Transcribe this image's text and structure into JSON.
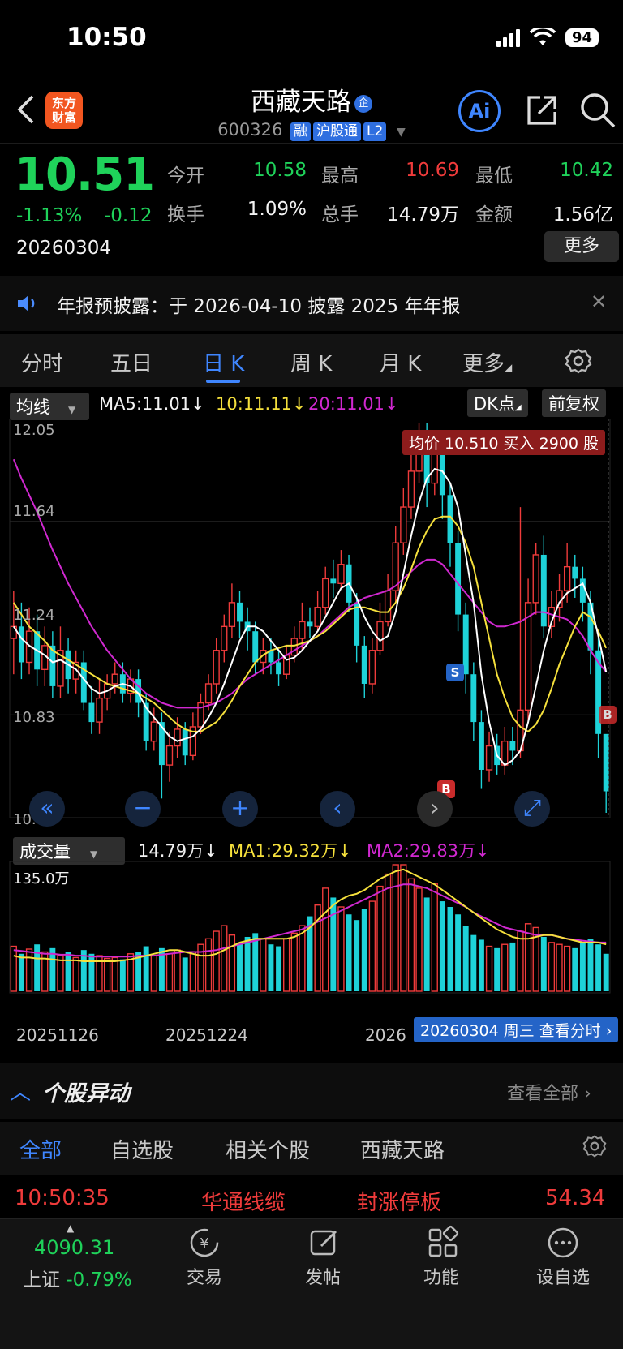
{
  "status": {
    "time": "10:50",
    "battery": "94"
  },
  "header": {
    "logo_line1": "东方",
    "logo_line2": "财富",
    "stock_name": "西藏天路",
    "name_tag": "企",
    "stock_code": "600326",
    "badges": [
      "融",
      "沪股通",
      "L2"
    ],
    "ai_label": "Ai"
  },
  "quote": {
    "price": "10.51",
    "change_pct": "-1.13%",
    "change_amt": "-0.12",
    "date": "20260304",
    "fields": [
      {
        "label": "今开",
        "value": "10.58",
        "color": "#1fd25a"
      },
      {
        "label": "最高",
        "value": "10.69",
        "color": "#ef3b3b"
      },
      {
        "label": "最低",
        "value": "10.42",
        "color": "#1fd25a"
      },
      {
        "label": "换手",
        "value": "1.09%",
        "color": "#f2f2f2"
      },
      {
        "label": "总手",
        "value": "14.79万",
        "color": "#f2f2f2"
      },
      {
        "label": "金额",
        "value": "1.56亿",
        "color": "#f2f2f2"
      }
    ],
    "more_label": "更多"
  },
  "notice": {
    "text": "年报预披露：于 2026-04-10 披露 2025 年年报"
  },
  "ktabs": [
    "分时",
    "五日",
    "日 K",
    "周 K",
    "月 K",
    "更多"
  ],
  "kchart": {
    "indicator_label": "均线",
    "ma5": "MA5:11.01↓",
    "ma10": "10:11.11↓",
    "ma20": "20:11.01↓",
    "dk_label": "DK点",
    "fq_label": "前复权",
    "avg_tag": "均价 10.510 买入 2900 股",
    "y_labels": [
      "12.05",
      "11.64",
      "11.24",
      "10.83",
      "10.42"
    ],
    "marker_s": "S",
    "marker_b": "B"
  },
  "volume": {
    "indicator_label": "成交量",
    "current": "14.79万↓",
    "ma1": "MA1:29.32万↓",
    "ma2": "MA2:29.83万↓",
    "max_label": "135.0万",
    "x_labels": [
      "20251126",
      "20251224",
      "2026"
    ],
    "date_tag": "20260304 周三  查看分时"
  },
  "colors": {
    "up": "#ef3b3b",
    "down": "#1ed2d8",
    "ma5": "#ffffff",
    "ma10": "#f5e03c",
    "ma20": "#d028d0",
    "accent": "#3f86ff"
  },
  "chart_data": {
    "type": "candlestick",
    "ylim": [
      10.42,
      12.05
    ],
    "candles": [
      [
        11.15,
        11.2,
        11.35,
        11.0
      ],
      [
        11.2,
        11.05,
        11.3,
        10.98
      ],
      [
        11.05,
        11.18,
        11.28,
        11.0
      ],
      [
        11.18,
        11.02,
        11.25,
        10.95
      ],
      [
        11.02,
        11.12,
        11.2,
        10.95
      ],
      [
        11.12,
        10.95,
        11.18,
        10.9
      ],
      [
        10.95,
        11.1,
        11.2,
        10.9
      ],
      [
        11.1,
        10.98,
        11.15,
        10.92
      ],
      [
        10.98,
        11.05,
        11.1,
        10.92
      ],
      [
        11.05,
        10.88,
        11.1,
        10.85
      ],
      [
        10.88,
        10.8,
        10.95,
        10.75
      ],
      [
        10.8,
        10.9,
        10.98,
        10.75
      ],
      [
        10.9,
        10.96,
        11.0,
        10.85
      ],
      [
        10.96,
        11.0,
        11.05,
        10.92
      ],
      [
        11.0,
        10.92,
        11.05,
        10.88
      ],
      [
        10.92,
        10.98,
        11.02,
        10.88
      ],
      [
        10.98,
        10.88,
        11.02,
        10.82
      ],
      [
        10.88,
        10.72,
        10.92,
        10.68
      ],
      [
        10.72,
        10.8,
        10.86,
        10.68
      ],
      [
        10.8,
        10.62,
        10.84,
        10.48
      ],
      [
        10.62,
        10.7,
        10.76,
        10.55
      ],
      [
        10.7,
        10.77,
        10.82,
        10.65
      ],
      [
        10.77,
        10.66,
        10.8,
        10.62
      ],
      [
        10.66,
        10.78,
        10.84,
        10.64
      ],
      [
        10.78,
        10.88,
        10.92,
        10.75
      ],
      [
        10.88,
        10.96,
        11.0,
        10.85
      ],
      [
        10.96,
        11.1,
        11.15,
        10.92
      ],
      [
        11.1,
        11.2,
        11.25,
        11.05
      ],
      [
        11.2,
        11.3,
        11.38,
        11.15
      ],
      [
        11.3,
        11.22,
        11.35,
        11.15
      ],
      [
        11.22,
        11.18,
        11.28,
        11.1
      ],
      [
        11.18,
        11.05,
        11.22,
        11.0
      ],
      [
        11.05,
        11.1,
        11.15,
        11.0
      ],
      [
        11.1,
        11.05,
        11.15,
        11.0
      ],
      [
        11.05,
        11.0,
        11.1,
        10.95
      ],
      [
        11.0,
        11.08,
        11.12,
        10.98
      ],
      [
        11.08,
        11.15,
        11.2,
        11.05
      ],
      [
        11.15,
        11.22,
        11.3,
        11.1
      ],
      [
        11.22,
        11.2,
        11.28,
        11.15
      ],
      [
        11.2,
        11.28,
        11.35,
        11.18
      ],
      [
        11.28,
        11.4,
        11.45,
        11.25
      ],
      [
        11.4,
        11.38,
        11.48,
        11.32
      ],
      [
        11.38,
        11.46,
        11.52,
        11.36
      ],
      [
        11.46,
        11.3,
        11.5,
        11.26
      ],
      [
        11.3,
        11.12,
        11.34,
        11.05
      ],
      [
        11.12,
        10.96,
        11.16,
        10.9
      ],
      [
        10.96,
        11.1,
        11.15,
        10.92
      ],
      [
        11.1,
        11.22,
        11.3,
        11.08
      ],
      [
        11.22,
        11.35,
        11.42,
        11.2
      ],
      [
        11.35,
        11.55,
        11.62,
        11.3
      ],
      [
        11.55,
        11.7,
        11.78,
        11.5
      ],
      [
        11.7,
        11.85,
        11.95,
        11.65
      ],
      [
        11.85,
        11.95,
        12.05,
        11.8
      ],
      [
        11.95,
        11.8,
        12.05,
        11.7
      ],
      [
        11.8,
        11.92,
        12.0,
        11.75
      ],
      [
        11.92,
        11.75,
        11.98,
        11.65
      ],
      [
        11.75,
        11.55,
        11.8,
        11.45
      ],
      [
        11.55,
        11.25,
        11.6,
        11.18
      ],
      [
        11.25,
        11.0,
        11.3,
        10.92
      ],
      [
        11.0,
        10.8,
        11.05,
        10.72
      ],
      [
        10.8,
        10.6,
        10.85,
        10.52
      ],
      [
        10.6,
        10.7,
        10.76,
        10.55
      ],
      [
        10.7,
        10.62,
        10.75,
        10.58
      ],
      [
        10.62,
        10.72,
        10.78,
        10.58
      ],
      [
        10.72,
        10.68,
        10.78,
        10.62
      ],
      [
        10.68,
        10.85,
        11.7,
        10.65
      ],
      [
        10.85,
        11.3,
        11.4,
        10.8
      ],
      [
        11.3,
        11.5,
        11.55,
        11.25
      ],
      [
        11.5,
        11.2,
        11.58,
        11.15
      ],
      [
        11.2,
        11.28,
        11.35,
        11.15
      ],
      [
        11.28,
        11.35,
        11.42,
        11.22
      ],
      [
        11.35,
        11.45,
        11.55,
        11.3
      ],
      [
        11.45,
        11.4,
        11.5,
        11.32
      ],
      [
        11.4,
        11.3,
        11.45,
        11.22
      ],
      [
        11.3,
        11.1,
        11.35,
        11.0
      ],
      [
        11.1,
        10.75,
        11.15,
        10.65
      ],
      [
        10.75,
        10.51,
        10.69,
        10.42
      ]
    ],
    "volumes": [
      48,
      40,
      45,
      50,
      42,
      46,
      38,
      42,
      36,
      44,
      40,
      38,
      35,
      36,
      34,
      40,
      42,
      48,
      38,
      46,
      40,
      44,
      36,
      42,
      50,
      56,
      64,
      70,
      60,
      52,
      58,
      62,
      56,
      50,
      48,
      56,
      62,
      70,
      80,
      92,
      110,
      100,
      90,
      82,
      76,
      88,
      96,
      112,
      125,
      135,
      135,
      120,
      110,
      100,
      115,
      96,
      90,
      82,
      70,
      60,
      55,
      48,
      46,
      50,
      52,
      64,
      72,
      68,
      58,
      52,
      50,
      48,
      46,
      52,
      56,
      50,
      40
    ],
    "ma5": [
      11.2,
      11.15,
      11.12,
      11.1,
      11.08,
      11.05,
      11.06,
      11.04,
      11.02,
      10.98,
      10.94,
      10.92,
      10.93,
      10.95,
      10.96,
      10.95,
      10.92,
      10.86,
      10.82,
      10.78,
      10.74,
      10.72,
      10.73,
      10.74,
      10.77,
      10.82,
      10.88,
      10.96,
      11.05,
      11.14,
      11.2,
      11.2,
      11.18,
      11.14,
      11.1,
      11.06,
      11.07,
      11.1,
      11.14,
      11.18,
      11.24,
      11.3,
      11.36,
      11.38,
      11.32,
      11.24,
      11.18,
      11.14,
      11.16,
      11.26,
      11.42,
      11.58,
      11.72,
      11.82,
      11.86,
      11.85,
      11.8,
      11.7,
      11.5,
      11.3,
      11.0,
      10.8,
      10.66,
      10.62,
      10.64,
      10.68,
      10.8,
      10.95,
      11.1,
      11.22,
      11.3,
      11.34,
      11.36,
      11.38,
      11.3,
      11.16,
      11.01
    ],
    "ma10": [
      11.3,
      11.25,
      11.2,
      11.17,
      11.14,
      11.1,
      11.08,
      11.06,
      11.04,
      11.02,
      11.0,
      10.98,
      10.96,
      10.95,
      10.94,
      10.93,
      10.92,
      10.9,
      10.88,
      10.85,
      10.82,
      10.79,
      10.77,
      10.76,
      10.76,
      10.78,
      10.8,
      10.84,
      10.89,
      10.95,
      11.0,
      11.05,
      11.08,
      11.1,
      11.11,
      11.12,
      11.12,
      11.13,
      11.14,
      11.16,
      11.18,
      11.21,
      11.24,
      11.27,
      11.28,
      11.28,
      11.27,
      11.26,
      11.26,
      11.3,
      11.36,
      11.44,
      11.53,
      11.6,
      11.65,
      11.66,
      11.66,
      11.62,
      11.55,
      11.45,
      11.3,
      11.15,
      11.0,
      10.9,
      10.82,
      10.78,
      10.76,
      10.79,
      10.85,
      10.94,
      11.04,
      11.12,
      11.2,
      11.26,
      11.24,
      11.18,
      11.11
    ],
    "ma20": [
      11.9,
      11.82,
      11.75,
      11.68,
      11.6,
      11.52,
      11.45,
      11.38,
      11.32,
      11.26,
      11.2,
      11.15,
      11.1,
      11.06,
      11.02,
      10.98,
      10.95,
      10.92,
      10.9,
      10.88,
      10.87,
      10.86,
      10.86,
      10.86,
      10.86,
      10.87,
      10.88,
      10.9,
      10.92,
      10.95,
      10.98,
      11.0,
      11.02,
      11.04,
      11.06,
      11.08,
      11.1,
      11.12,
      11.14,
      11.16,
      11.19,
      11.22,
      11.25,
      11.28,
      11.3,
      11.32,
      11.33,
      11.34,
      11.35,
      11.37,
      11.4,
      11.43,
      11.46,
      11.48,
      11.48,
      11.46,
      11.42,
      11.38,
      11.34,
      11.3,
      11.26,
      11.22,
      11.2,
      11.2,
      11.21,
      11.22,
      11.24,
      11.26,
      11.26,
      11.25,
      11.24,
      11.23,
      11.2,
      11.16,
      11.1,
      11.05,
      11.01
    ],
    "vol_ma1": [
      38,
      36,
      36,
      35,
      35,
      34,
      33,
      33,
      33,
      32,
      32,
      32,
      32,
      32,
      33,
      34,
      36,
      38,
      40,
      42,
      44,
      44,
      42,
      40,
      38,
      38,
      40,
      44,
      48,
      52,
      54,
      56,
      56,
      56,
      56,
      56,
      58,
      62,
      68,
      76,
      84,
      92,
      98,
      102,
      104,
      108,
      114,
      120,
      124,
      128,
      130,
      126,
      122,
      118,
      114,
      108,
      102,
      96,
      90,
      84,
      78,
      72,
      66,
      62,
      58,
      56,
      56,
      58,
      60,
      60,
      58,
      56,
      54,
      52,
      52,
      52,
      50
    ],
    "vol_ma2": [
      44,
      43,
      42,
      41,
      40,
      40,
      39,
      39,
      38,
      38,
      37,
      37,
      37,
      37,
      37,
      37,
      38,
      38,
      38,
      39,
      40,
      41,
      42,
      42,
      42,
      43,
      44,
      46,
      48,
      50,
      52,
      54,
      56,
      58,
      60,
      62,
      64,
      66,
      70,
      74,
      78,
      82,
      86,
      90,
      94,
      98,
      102,
      106,
      110,
      112,
      114,
      114,
      112,
      110,
      106,
      102,
      98,
      94,
      90,
      84,
      80,
      76,
      72,
      68,
      66,
      64,
      62,
      60,
      60,
      60,
      58,
      56,
      55,
      54,
      53,
      52,
      52
    ]
  },
  "movement": {
    "title": "个股异动",
    "view_all": "查看全部",
    "tabs": [
      "全部",
      "自选股",
      "相关个股",
      "西藏天路"
    ],
    "row": {
      "time": "10:50:35",
      "name": "华通线缆",
      "event": "封涨停板",
      "value": "54.34"
    }
  },
  "bottom_nav": {
    "index_value": "4090.31",
    "index_name": "上证",
    "index_change": "-0.79%",
    "items": [
      "交易",
      "发帖",
      "功能",
      "设自选"
    ]
  }
}
